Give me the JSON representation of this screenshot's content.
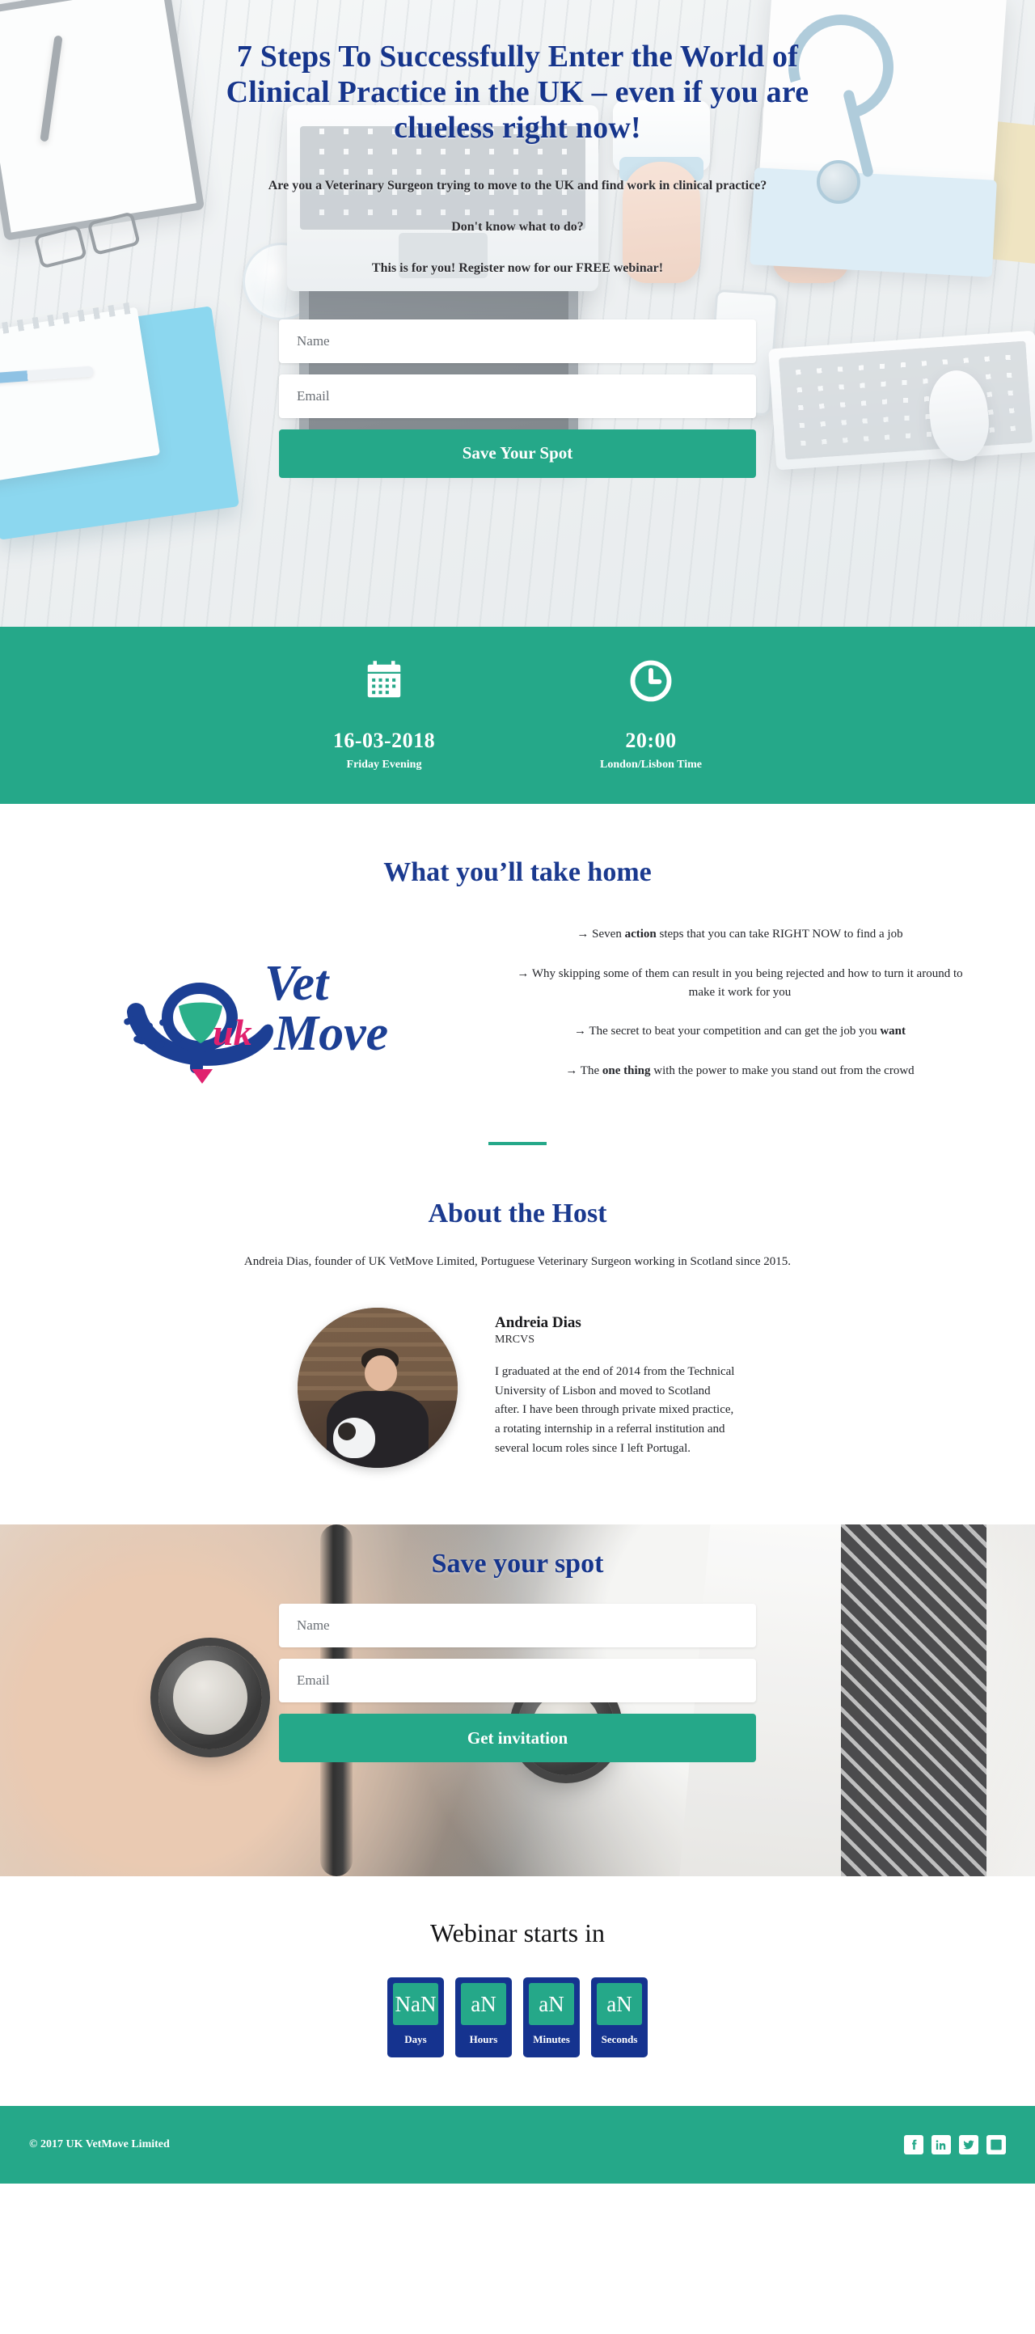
{
  "hero": {
    "title": "7 Steps To Successfully Enter the World of Clinical Practice in the UK – even if you are clueless right now!",
    "sub_line1": "Are you a Veterinary Surgeon trying to move to the UK and find work in clinical practice?",
    "sub_line2": "Don't know what to do?",
    "sub_line3": "This is for you! Register now for our FREE webinar!",
    "name_placeholder": "Name",
    "email_placeholder": "Email",
    "name_value": "",
    "email_value": "",
    "submit_label": "Save Your Spot"
  },
  "datetime": {
    "date_icon": "calendar-icon",
    "date_value": "16-03-2018",
    "date_label": "Friday Evening",
    "time_icon": "clock-icon",
    "time_value": "20:00",
    "time_label": "London/Lisbon Time"
  },
  "takehome": {
    "title": "What you’ll take home",
    "logo_alt": "UK Vet Move",
    "logo_text_uk": "UK",
    "logo_text_vet": "Vet",
    "logo_text_move": "Move",
    "benefits": [
      {
        "arrow": "→",
        "pre": "Seven ",
        "bold": "action",
        "post": " steps that you can take RIGHT NOW to find a job"
      },
      {
        "arrow": "→",
        "pre": "Why skipping some of them can result in you being rejected and how to turn it around to make it work for you",
        "bold": "",
        "post": ""
      },
      {
        "arrow": "→",
        "pre": "The secret to beat your competition and can get the job you  ",
        "bold": "want",
        "post": ""
      },
      {
        "arrow": "→",
        "pre": "The ",
        "bold": "one thing",
        "post": " with the power to make you stand out from the crowd"
      }
    ]
  },
  "host": {
    "title": "About the Host",
    "intro": "Andreia Dias, founder of UK VetMove Limited, Portuguese Veterinary Surgeon working in Scotland since 2015.",
    "name": "Andreia Dias",
    "credential": "MRCVS",
    "bio": "I graduated at the end of 2014 from the Technical University of Lisbon and moved to Scotland after. I have been through private mixed practice, a rotating internship in a referral institution and several locum roles since I left Portugal.",
    "photo_alt": "Andreia Dias portrait"
  },
  "spot": {
    "title": "Save your spot",
    "name_placeholder": "Name",
    "email_placeholder": "Email",
    "name_value": "",
    "email_value": "",
    "submit_label": "Get invitation"
  },
  "countdown": {
    "title": "Webinar starts in",
    "units": [
      {
        "value": "NaN",
        "label": "Days"
      },
      {
        "value": "aN",
        "label": "Hours"
      },
      {
        "value": "aN",
        "label": "Minutes"
      },
      {
        "value": "aN",
        "label": "Seconds"
      }
    ]
  },
  "footer": {
    "copyright": "© 2017 UK VetMove Limited",
    "socials": [
      {
        "name": "facebook-icon"
      },
      {
        "name": "linkedin-icon"
      },
      {
        "name": "twitter-icon"
      },
      {
        "name": "youtube-icon"
      }
    ]
  },
  "colors": {
    "teal": "#25a889",
    "navy": "#16358c",
    "deep_blue": "#15338f",
    "pink": "#e0216e",
    "green": "#2bb08a"
  }
}
